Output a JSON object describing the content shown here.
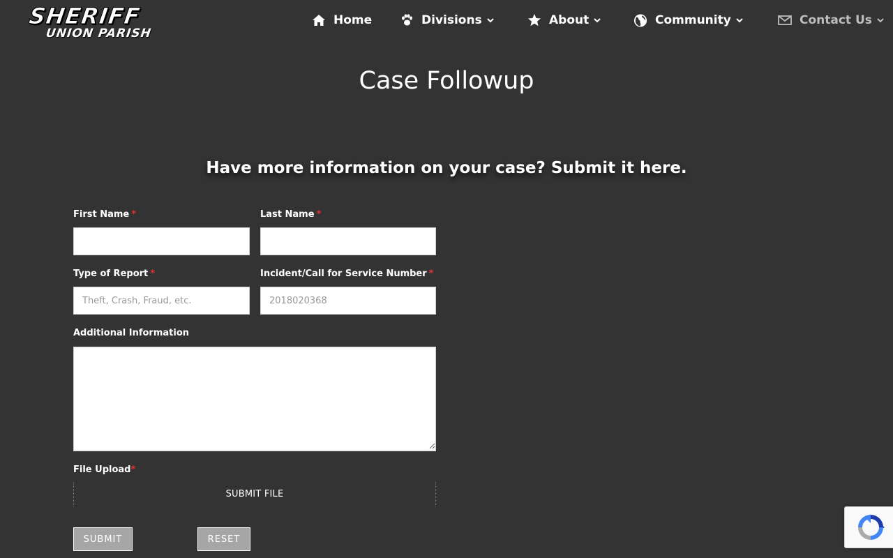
{
  "logo": {
    "line1": "SHERIFF",
    "line2": "UNION PARISH"
  },
  "nav": {
    "items": [
      {
        "label": "Home",
        "icon": "home-icon",
        "dropdown": false
      },
      {
        "label": "Divisions",
        "icon": "paw-icon",
        "dropdown": true
      },
      {
        "label": "About",
        "icon": "star-icon",
        "dropdown": true
      },
      {
        "label": "Community",
        "icon": "globe-icon",
        "dropdown": true
      },
      {
        "label": "Contact Us",
        "icon": "envelope-icon",
        "dropdown": true
      }
    ]
  },
  "page": {
    "title": "Case Followup",
    "subtitle": "Have more information on your case? Submit it here."
  },
  "form": {
    "first_name": {
      "label": "First Name",
      "required_mark": "*",
      "value": ""
    },
    "last_name": {
      "label": "Last Name",
      "required_mark": "*",
      "value": ""
    },
    "report_type": {
      "label": "Type of Report",
      "required_mark": "*",
      "placeholder": "Theft, Crash, Fraud, etc."
    },
    "incident_number": {
      "label": "Incident/Call for Service Number",
      "required_mark": "*",
      "placeholder": "2018020368"
    },
    "additional_info": {
      "label": "Additional Information",
      "value": ""
    },
    "file_upload": {
      "label": "File Upload",
      "required_mark": "*",
      "button_label": "SUBMIT FILE"
    },
    "submit_label": "SUBMIT",
    "reset_label": "RESET"
  },
  "colors": {
    "background": "#333333",
    "required": "#e03131",
    "button": "#a6a6a6",
    "muted_nav": "#bdbdbd"
  },
  "recaptcha": {
    "icon": "recaptcha-icon"
  }
}
